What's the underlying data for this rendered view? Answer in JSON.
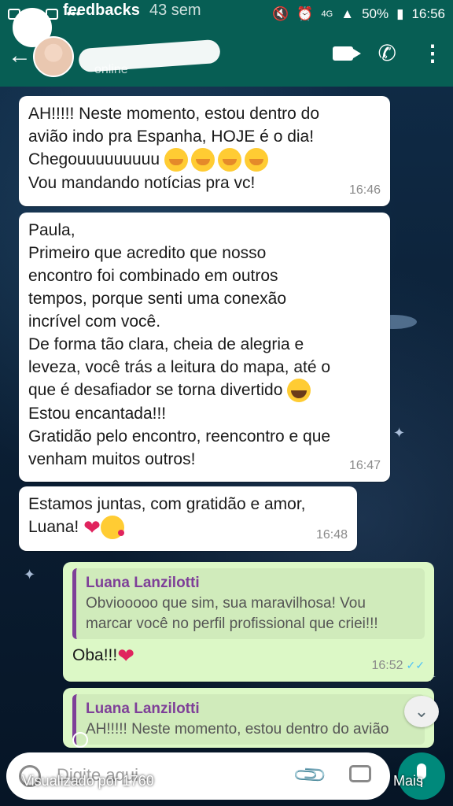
{
  "statusbar": {
    "battery": "50%",
    "time": "16:56",
    "network": "4G"
  },
  "story": {
    "name": "feedbacks",
    "age": "43 sem"
  },
  "header": {
    "subtitle": "online"
  },
  "messages": [
    {
      "lines": [
        "AH!!!!! Neste momento, estou dentro do",
        "avião indo pra Espanha, HOJE é o dia!",
        "Chegouuuuuuuuu",
        "Vou mandando notícias pra vc!"
      ],
      "time": "16:46"
    },
    {
      "lines": [
        "Paula,",
        "Primeiro que acredito que nosso",
        "encontro foi combinado em outros",
        "tempos, porque senti uma conexão",
        "incrível com você.",
        "De forma tão clara, cheia de alegria e",
        "leveza, você trás a leitura do mapa, até o",
        "que é desafiador se torna divertido",
        "Estou encantada!!!",
        "Gratidão pelo encontro, reencontro e que",
        "venham muitos outros!"
      ],
      "time": "16:47"
    },
    {
      "lines": [
        "Estamos juntas, com gratidão e amor,",
        "Luana!"
      ],
      "time": "16:48"
    },
    {
      "quote_name": "Luana Lanzilotti",
      "quote_lines": [
        "Obviooooo que sim, sua maravilhosa! Vou",
        "marcar você no perfil profissional que criei!!!"
      ],
      "text": "Oba!!!",
      "time": "16:52"
    },
    {
      "quote_name": "Luana Lanzilotti",
      "quote_lines": [
        "AH!!!!! Neste momento, estou dentro do avião"
      ]
    }
  ],
  "input": {
    "placeholder": "Digite aqui..."
  },
  "story_footer": {
    "viewed": "Visualizado por 1760",
    "more": "Mais"
  },
  "icons": [
    "back-arrow-icon",
    "video-call-icon",
    "phone-icon",
    "more-options-icon",
    "emoji-icon",
    "attach-icon",
    "camera-icon",
    "mic-icon",
    "chevron-down-icon"
  ]
}
